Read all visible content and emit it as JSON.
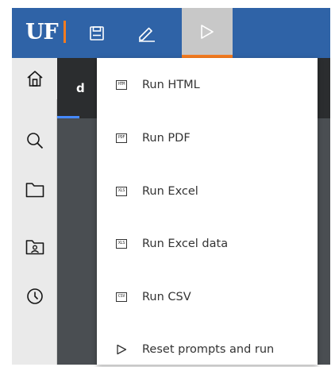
{
  "header": {
    "logo_text": "UF",
    "accent_color": "#f57c20",
    "brand_color": "#2f63a7",
    "buttons": [
      {
        "name": "save-button",
        "icon": "floppy-disk-icon"
      },
      {
        "name": "edit-button",
        "icon": "pencil-icon"
      },
      {
        "name": "run-button",
        "icon": "play-icon",
        "active": true
      }
    ]
  },
  "sidebar": {
    "items": [
      {
        "name": "sidebar-item-home",
        "icon": "home-icon"
      },
      {
        "name": "sidebar-item-search",
        "icon": "search-icon"
      },
      {
        "name": "sidebar-item-content",
        "icon": "folder-icon"
      },
      {
        "name": "sidebar-item-team",
        "icon": "team-folder-icon"
      },
      {
        "name": "sidebar-item-recent",
        "icon": "clock-icon"
      }
    ]
  },
  "background": {
    "tab_letter": "d"
  },
  "run_menu": {
    "items": [
      {
        "label": "Run HTML",
        "badge": "HTM"
      },
      {
        "label": "Run PDF",
        "badge": "PDF"
      },
      {
        "label": "Run Excel",
        "badge": "XLS"
      },
      {
        "label": "Run Excel data",
        "badge": "XLS"
      },
      {
        "label": "Run CSV",
        "badge": "CSV"
      },
      {
        "label": "Reset prompts and run",
        "badge": ""
      }
    ]
  }
}
